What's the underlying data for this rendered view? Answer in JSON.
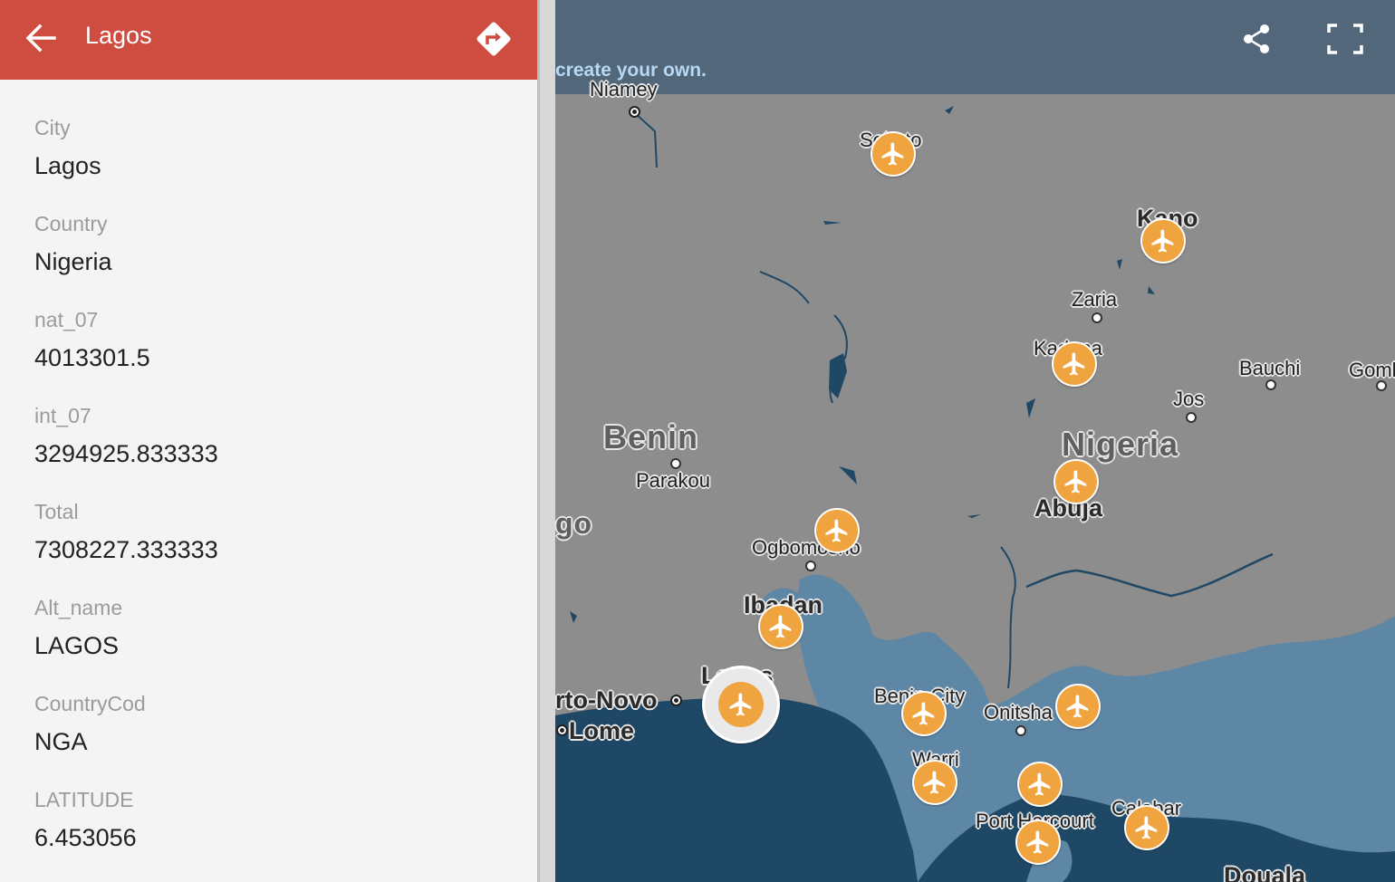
{
  "panel": {
    "title": "Lagos",
    "fields": [
      {
        "label": "City",
        "value": "Lagos"
      },
      {
        "label": "Country",
        "value": "Nigeria"
      },
      {
        "label": "nat_07",
        "value": "4013301.5"
      },
      {
        "label": "int_07",
        "value": "3294925.833333"
      },
      {
        "label": "Total",
        "value": "7308227.333333"
      },
      {
        "label": "Alt_name",
        "value": "LAGOS"
      },
      {
        "label": "CountryCod",
        "value": "NGA"
      },
      {
        "label": "LATITUDE",
        "value": "6.453056"
      }
    ]
  },
  "map": {
    "topbar_text": "create your own.",
    "labels": {
      "niamey": "Niamey",
      "sokoto": "Sokoto",
      "kano": "Kano",
      "zaria": "Zaria",
      "kaduna": "Kaduna",
      "bauchi": "Bauchi",
      "gombe": "Gomb",
      "jos": "Jos",
      "benin_country": "Benin",
      "parakou": "Parakou",
      "nigeria_country": "Nigeria",
      "abuja": "Abuja",
      "togo": "go",
      "ogbomosho": "Ogbomosho",
      "ibadan": "Ibadan",
      "lagos": "Lagos",
      "porto_novo": "rto-Novo",
      "lome": "Lome",
      "benin_city": "Benin City",
      "onitsha": "Onitsha",
      "warri": "Warri",
      "port_harcourt": "Port Harcourt",
      "calabar": "Calabar",
      "douala": "Douala"
    },
    "markers": [
      "Sokoto",
      "Kano",
      "Kaduna",
      "Abuja",
      "Ilorin",
      "Ibadan",
      "Lagos",
      "Benin City",
      "Enugu",
      "Warri",
      "Owerri",
      "Port Harcourt",
      "Calabar"
    ],
    "selected_marker": "Lagos",
    "colors": {
      "land": "#8d8d8d",
      "water": "#1f4866",
      "wetland": "#5e87a6",
      "marker": "#f0a440",
      "header": "#cf4c40",
      "topbar": "#52677a"
    },
    "icons": {
      "back": "arrow-left-icon",
      "directions": "directions-icon",
      "share": "share-icon",
      "fullscreen": "fullscreen-icon",
      "marker": "airplane-icon"
    }
  }
}
